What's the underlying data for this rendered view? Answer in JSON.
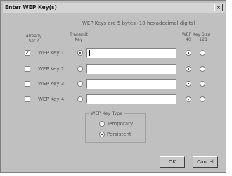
{
  "window": {
    "title": "Enter WEP Key(s)",
    "close_glyph": "×"
  },
  "info_text": "WEP Keys are 5 bytes (10 hexadecimal digits)",
  "headers": {
    "already_set": "Already Set ?",
    "transmit_key": "Transmit Key",
    "wep_key_size": "WEP Key Size",
    "size_40": "40",
    "size_128": "128"
  },
  "keys": [
    {
      "label": "WEP Key 1:",
      "already_set": true,
      "transmit": true,
      "value": "",
      "size": "40"
    },
    {
      "label": "WEP Key 2:",
      "already_set": false,
      "transmit": false,
      "value": "",
      "size": "40"
    },
    {
      "label": "WEP Key 3:",
      "already_set": false,
      "transmit": false,
      "value": "",
      "size": "40"
    },
    {
      "label": "WEP Key 4:",
      "already_set": false,
      "transmit": false,
      "value": "",
      "size": "40"
    }
  ],
  "key_type": {
    "label": "WEP Key Type",
    "options": [
      {
        "label": "Temporary",
        "selected": false
      },
      {
        "label": "Persistent",
        "selected": true
      }
    ]
  },
  "buttons": {
    "ok": "OK",
    "cancel": "Cancel"
  }
}
